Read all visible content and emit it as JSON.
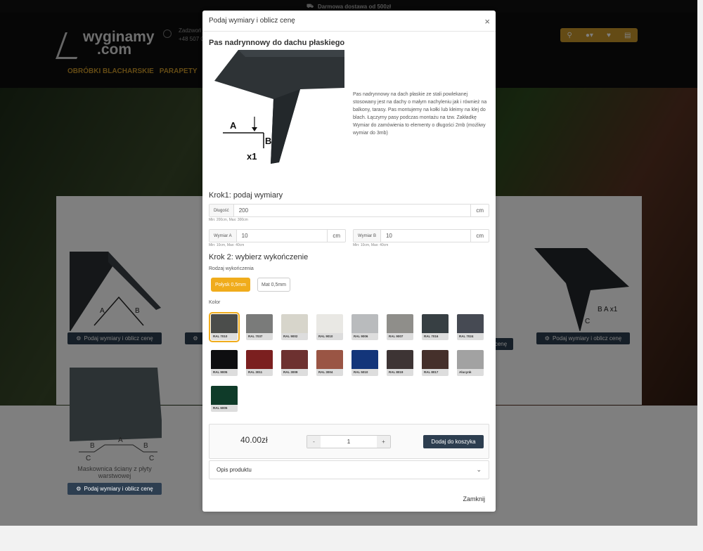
{
  "topbar": {
    "text": "Darmowa dostawa od 500zł",
    "icon": "truck-icon"
  },
  "header": {
    "logo_line1": "wyginamy",
    "logo_line2": ".com",
    "phone_label": "Zadzwoń",
    "phone_number": "+48 507 0"
  },
  "nav": {
    "items": [
      "OBRÓBKI BLACHARSKIE",
      "PARAPETY",
      "S"
    ]
  },
  "products": {
    "card_button": "Podaj wymiary i oblicz cenę",
    "card_button_short": "cenę",
    "card_label": "Maskownica ściany z płyty warstwowej"
  },
  "modal": {
    "header_title": "Podaj wymiary i oblicz cenę",
    "product_title": "Pas nadrynnowy do dachu płaskiego",
    "description": "Pas nadrynnowy na dach płaskie ze stali powlekanej stosowany jest na dachy o małym nachyleniu jak i również na balkony, tarasy. Pas montujemy na kołki lub kleimy na klej do blach. Łączymy pasy podczas montażu na tzw. Zakładkę Wymiar do zamówienia to elementy o długości 2mb (możliwy wymiar do 3mb)",
    "step1_title": "Krok1: podaj wymiary",
    "length": {
      "label": "Długość",
      "value": "200",
      "unit": "cm",
      "hint": "Min: 200cm, Max: 300cm"
    },
    "dim_a": {
      "label": "Wymiar A",
      "value": "10",
      "unit": "cm",
      "hint": "Min: 10cm, Max: 40cm"
    },
    "dim_b": {
      "label": "Wymiar B",
      "value": "10",
      "unit": "cm",
      "hint": "Min: 10cm, Max: 40cm"
    },
    "step2_title": "Krok 2: wybierz wykończenie",
    "finish_label": "Rodzaj wykończenia",
    "finish_options": [
      "Połysk 0,5mm",
      "Mat 0,5mm"
    ],
    "finish_selected": "Połysk 0,5mm",
    "color_label": "Kolor",
    "colors": [
      {
        "name": "RAL 7010",
        "hex": "#4b4d4b"
      },
      {
        "name": "RAL 7037",
        "hex": "#7a7b7a"
      },
      {
        "name": "RAL 9002",
        "hex": "#d7d5cb"
      },
      {
        "name": "RAL 9010",
        "hex": "#e9e8e4"
      },
      {
        "name": "RAL 9006",
        "hex": "#b9bbbd"
      },
      {
        "name": "RAL 9007",
        "hex": "#8f8e8a"
      },
      {
        "name": "RAL 7016",
        "hex": "#373f43"
      },
      {
        "name": "RAL 7024",
        "hex": "#464a53"
      },
      {
        "name": "RAL 9005",
        "hex": "#0e0e10"
      },
      {
        "name": "RAL 3011",
        "hex": "#7b1f1f"
      },
      {
        "name": "RAL 3009",
        "hex": "#6d3130"
      },
      {
        "name": "RAL 3004",
        "hex": "#9a5544"
      },
      {
        "name": "RAL 5010",
        "hex": "#13357a"
      },
      {
        "name": "RAL 8019",
        "hex": "#3d3434"
      },
      {
        "name": "RAL 8017",
        "hex": "#45302b"
      },
      {
        "name": "Alucynk",
        "hex": "#a2a2a2"
      },
      {
        "name": "RAL 6005",
        "hex": "#0f3b29"
      }
    ],
    "selected_color": "RAL 7010",
    "price": "40.00zł",
    "qty_minus": "-",
    "qty_value": "1",
    "qty_plus": "+",
    "add_to_cart": "Dodaj do koszyka",
    "opis": "Opis produktu",
    "close": "Zamknij",
    "close_x": "×"
  }
}
